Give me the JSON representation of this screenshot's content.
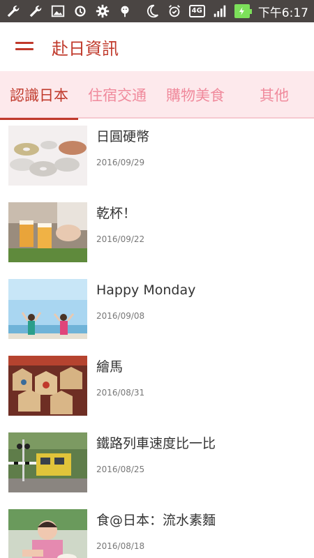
{
  "status_bar": {
    "time": "下午6:17",
    "network": "4G",
    "left_icons": [
      "wrench-icon",
      "wrench-icon",
      "image-icon",
      "sync-icon",
      "gear-icon",
      "android-icon"
    ],
    "right_icons": [
      "moon-icon",
      "alarm-icon",
      "network-badge",
      "signal-icon",
      "battery-icon"
    ]
  },
  "app_bar": {
    "title": "赴日資訊",
    "menu_icon": "hamburger-menu-icon"
  },
  "tabs": [
    {
      "label": "認識日本",
      "active": true
    },
    {
      "label": "住宿交通",
      "active": false
    },
    {
      "label": "購物美食",
      "active": false
    },
    {
      "label": "其他",
      "active": false
    }
  ],
  "articles": [
    {
      "title": "日圓硬幣",
      "date": "2016/09/29",
      "thumb": "coins-photo"
    },
    {
      "title": "乾杯！",
      "date": "2016/09/22",
      "thumb": "beer-toast-photo"
    },
    {
      "title": "Happy Monday",
      "date": "2016/09/08",
      "thumb": "beach-people-photo"
    },
    {
      "title": "繪馬",
      "date": "2016/08/31",
      "thumb": "ema-plaques-photo"
    },
    {
      "title": "鐵路列車速度比一比",
      "date": "2016/08/25",
      "thumb": "train-crossing-photo"
    },
    {
      "title": "食@日本：流水素麵",
      "date": "2016/08/18",
      "thumb": "child-noodles-photo"
    }
  ],
  "colors": {
    "accent": "#c0392b",
    "tab_background": "#fde9ec",
    "tab_inactive": "#f08a9c",
    "status_bar": "#4a4543"
  }
}
